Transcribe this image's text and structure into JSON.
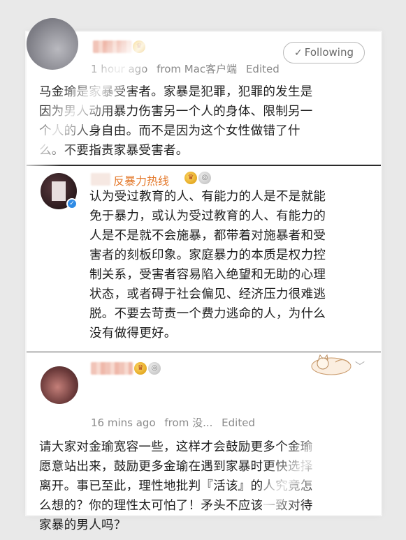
{
  "posts": [
    {
      "author": "",
      "time": "1 hour ago",
      "source": "from Mac客户端",
      "edited": "Edited",
      "follow_label": "Following",
      "text": "马金瑜是家暴受害者。家暴是犯罪，犯罪的发生是\n因为男人动用暴力伤害另一个人的身体、限制另一\n个人的人身自由。而不是因为这个女性做错了什\n么。不要指责家暴受害者。"
    },
    {
      "author": "反暴力热线",
      "text": "认为受过教育的人、有能力的人是不是就能\n免于暴力，或认为受过教育的人、有能力的\n人是不是就不会施暴，都带着对施暴者和受\n害者的刻板印象。家庭暴力的本质是权力控\n制关系，受害者容易陷入绝望和无助的心理\n状态，或者碍于社会偏见、经济压力很难逃\n脱。不要去苛责一个费力逃命的人，为什么\n没有做得更好。"
    },
    {
      "time": "16 mins ago",
      "source": "from 没...",
      "edited": "Edited",
      "text": "请大家对金瑜宽容一些，这样才会鼓励更多个金瑜\n愿意站出来，鼓励更多金瑜在遇到家暴时更快选择\n离开。事已至此，理性地批判『活该』的人究竟怎\n么想的？你的理性太可怕了！矛头不应该一致对待\n家暴的男人吗？"
    }
  ],
  "icons": {
    "crown": "crown-badge-icon",
    "verified": "verified-badge-icon",
    "check": "check-icon",
    "chevron": "chevron-down-icon"
  },
  "colors": {
    "org_name": "#e47b2f",
    "meta": "#8a8a8a",
    "verified": "#2f8be5"
  }
}
